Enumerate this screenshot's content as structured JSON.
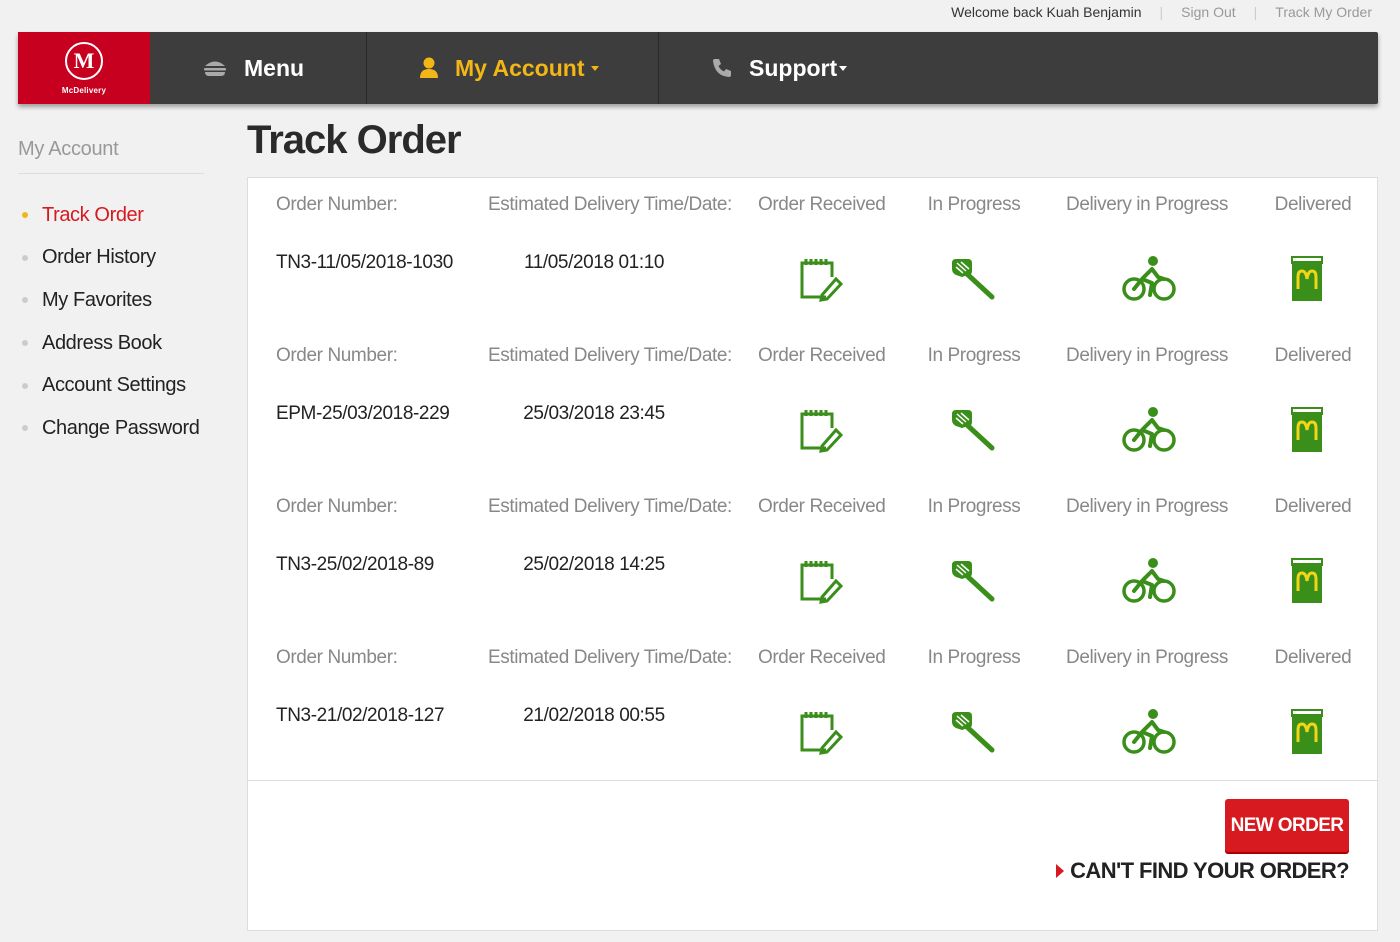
{
  "topbar": {
    "welcome": "Welcome back Kuah Benjamin",
    "sign_out": "Sign Out",
    "track": "Track My Order"
  },
  "logo": {
    "mark": "M",
    "brand": "McDelivery"
  },
  "nav": {
    "menu": {
      "label": "Menu",
      "icon": "burger-icon"
    },
    "account": {
      "label": "My Account",
      "icon": "user-icon"
    },
    "support": {
      "label": "Support",
      "icon": "phone-icon"
    }
  },
  "sidebar": {
    "title": "My Account",
    "items": [
      {
        "label": "Track Order"
      },
      {
        "label": "Order History"
      },
      {
        "label": "My Favorites"
      },
      {
        "label": "Address Book"
      },
      {
        "label": "Account Settings"
      },
      {
        "label": "Change Password"
      }
    ]
  },
  "page": {
    "title": "Track Order"
  },
  "labels": {
    "order_number": "Order Number:",
    "eta": "Estimated Delivery Time/Date:",
    "received": "Order Received",
    "in_progress": "In Progress",
    "delivery": "Delivery in Progress",
    "delivered": "Delivered"
  },
  "orders": [
    {
      "number": "TN3-11/05/2018-1030",
      "eta": "11/05/2018 01:10"
    },
    {
      "number": "EPM-25/03/2018-229",
      "eta": "25/03/2018 23:45"
    },
    {
      "number": "TN3-25/02/2018-89",
      "eta": "25/02/2018 14:25"
    },
    {
      "number": "TN3-21/02/2018-127",
      "eta": "21/02/2018 00:55"
    }
  ],
  "actions": {
    "new_order": "NEW ORDER",
    "cant_find": "CAN'T FIND YOUR ORDER?"
  },
  "colors": {
    "brand_red": "#d71920",
    "accent_yellow": "#f2b616",
    "status_green": "#3a8e1a",
    "nav_bg": "#3d3d3d"
  }
}
